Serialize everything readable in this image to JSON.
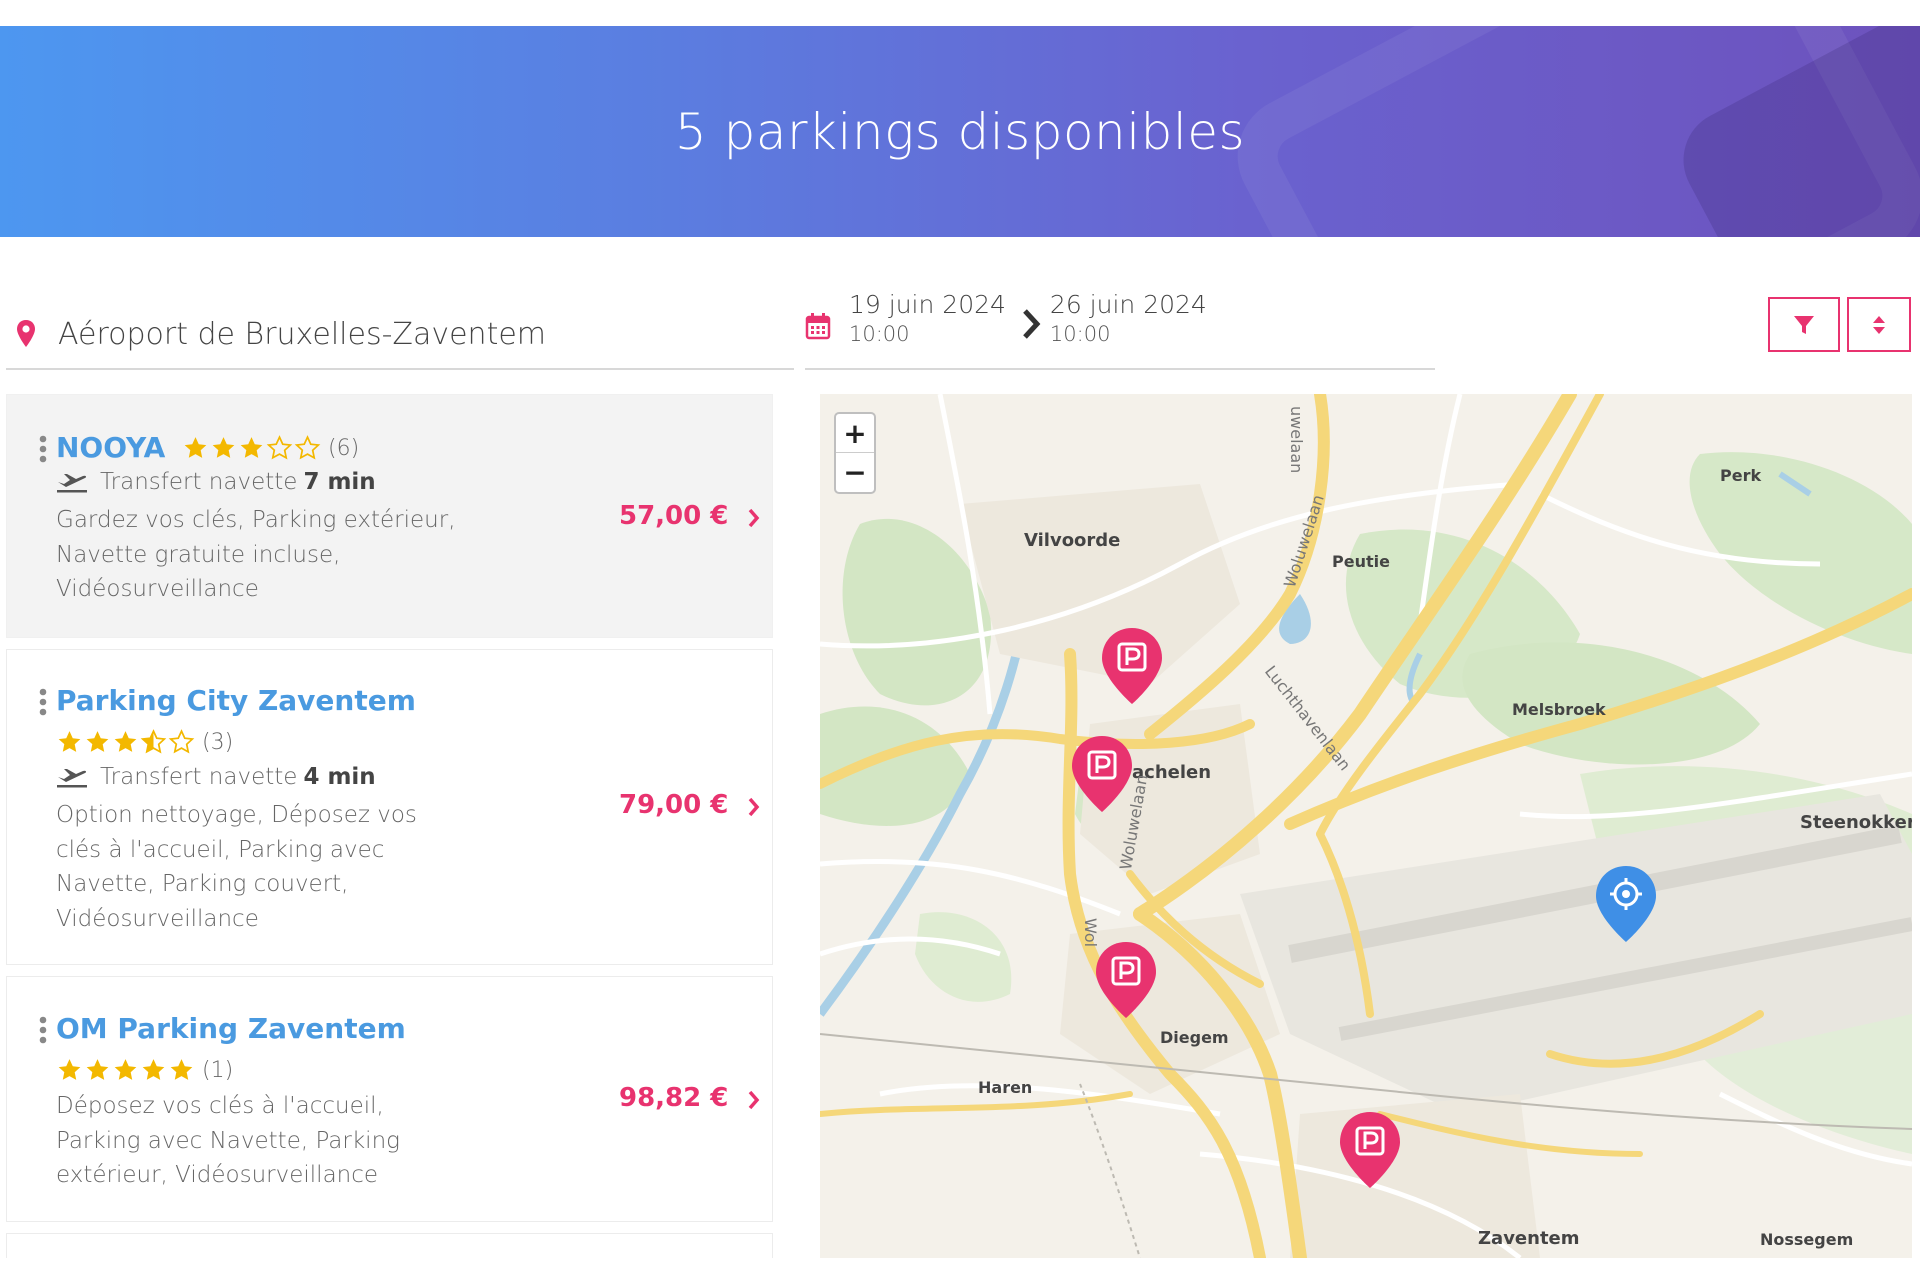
{
  "hero": {
    "title": "5 parkings disponibles"
  },
  "search": {
    "location": "Aéroport de Bruxelles-Zaventem",
    "start_date": "19 juin 2024",
    "start_time": "10:00",
    "end_date": "26 juin 2024",
    "end_time": "10:00"
  },
  "toolbar": {
    "filter_icon": "funnel-icon",
    "sort_icon": "sort-icon",
    "accent": "#e8336f"
  },
  "parkings": [
    {
      "name": "NOOYA",
      "rating": 3,
      "reviews": "(6)",
      "shuttle_label": "Transfert navette",
      "shuttle_time": "7 min",
      "features_lines": [
        "Gardez vos clés, Parking extérieur,",
        "Navette gratuite incluse,",
        "Vidéosurveillance"
      ],
      "price": "57,00 €"
    },
    {
      "name": "Parking City Zaventem",
      "rating": 3.5,
      "reviews": "(3)",
      "shuttle_label": "Transfert navette",
      "shuttle_time": "4 min",
      "features_lines": [
        "Option nettoyage, Déposez vos",
        "clés à l'accueil, Parking avec",
        "Navette, Parking couvert,",
        "Vidéosurveillance"
      ],
      "price": "79,00 €"
    },
    {
      "name": "OM Parking Zaventem",
      "rating": 5,
      "reviews": "(1)",
      "features_lines": [
        "Déposez vos clés à l'accueil,",
        "Parking avec Navette, Parking",
        "extérieur, Vidéosurveillance"
      ],
      "price": "98,82 €"
    }
  ],
  "map": {
    "zoom_in": "+",
    "zoom_out": "−",
    "labels": {
      "vilvoorde": "Vilvoorde",
      "peutie": "Peutie",
      "perk": "Perk",
      "melsbroek": "Melsbroek",
      "machelen": "achelen",
      "steenokkerzeel": "Steenokker",
      "diegem": "Diegem",
      "haren": "Haren",
      "zaventem": "Zaventem",
      "nossegem": "Nossegem",
      "woluwelaan_top": "uwelaan",
      "woluwelaan_mid": "Woluwelaan",
      "woluwelaan_left": "Woluwelaan",
      "woluwelaan_low": "Wol",
      "luchthavenlaan": "Luchthavenlaan"
    },
    "marker_colors": {
      "parking": "#e8336f",
      "airport": "#3f8fe6"
    }
  }
}
